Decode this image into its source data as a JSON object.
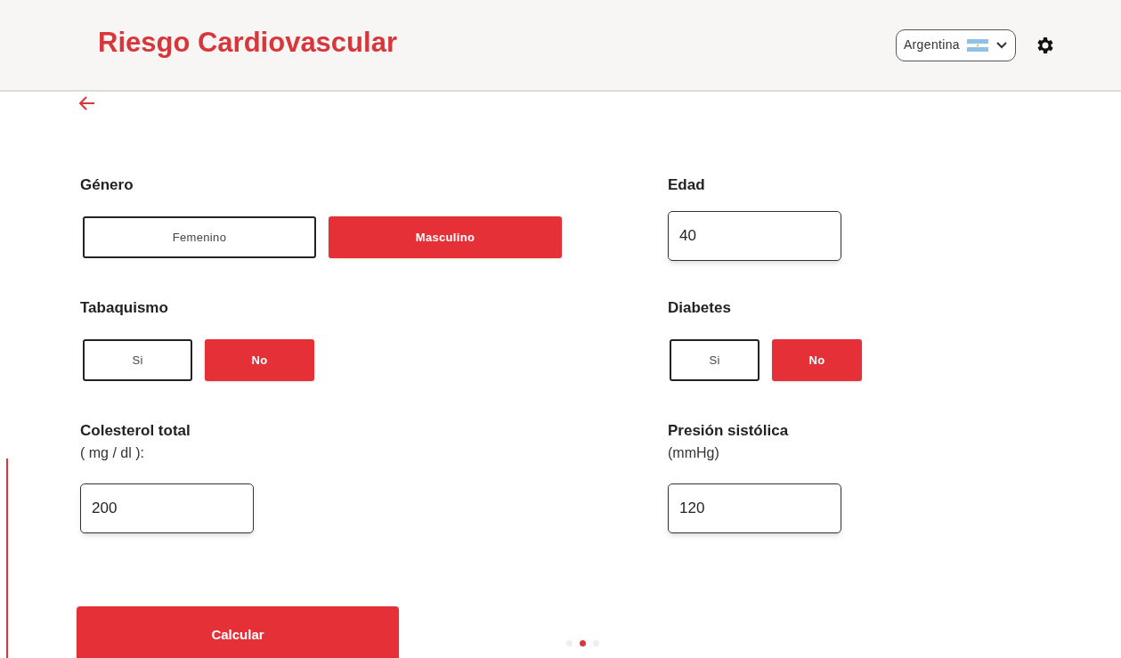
{
  "header": {
    "title": "Riesgo Cardiovascular",
    "country_select": {
      "value": "Argentina"
    }
  },
  "rows": [
    [
      {
        "kind": "toggle",
        "label": "Género",
        "options": [
          {
            "label": "Femenino",
            "selected": false
          },
          {
            "label": "Masculino",
            "selected": true
          }
        ]
      },
      {
        "kind": "input",
        "label": "Edad",
        "value": "40"
      }
    ],
    [
      {
        "kind": "toggle",
        "label": "Tabaquismo",
        "options": [
          {
            "label": "Si",
            "selected": false
          },
          {
            "label": "No",
            "selected": true
          }
        ]
      },
      {
        "kind": "toggle",
        "label": "Diabetes",
        "options": [
          {
            "label": "Si",
            "selected": false
          },
          {
            "label": "No",
            "selected": true
          }
        ]
      }
    ],
    [
      {
        "kind": "input",
        "label": "Colesterol total",
        "sublabel": "( mg / dl ):",
        "value": "200"
      },
      {
        "kind": "input",
        "label": "Presión sistólica",
        "sublabel": "(mmHg)",
        "value": "120"
      }
    ]
  ],
  "submit": "Calcular",
  "pager": [
    {
      "selected": false
    },
    {
      "selected": true
    },
    {
      "selected": false
    }
  ]
}
